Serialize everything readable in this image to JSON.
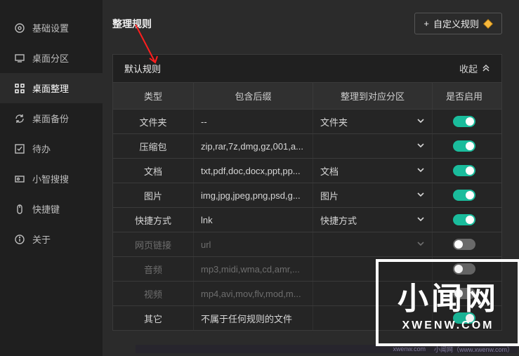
{
  "sidebar": {
    "items": [
      {
        "label": "基础设置",
        "icon": "gear-outline-icon",
        "active": false
      },
      {
        "label": "桌面分区",
        "icon": "monitor-icon",
        "active": false
      },
      {
        "label": "桌面整理",
        "icon": "grid-icon",
        "active": true
      },
      {
        "label": "桌面备份",
        "icon": "refresh-icon",
        "active": false
      },
      {
        "label": "待办",
        "icon": "checkbox-icon",
        "active": false
      },
      {
        "label": "小智搜搜",
        "icon": "search-box-icon",
        "active": false
      },
      {
        "label": "快捷键",
        "icon": "mouse-icon",
        "active": false
      },
      {
        "label": "关于",
        "icon": "info-icon",
        "active": false
      }
    ]
  },
  "section_title": "整理规则",
  "custom_rule_button": {
    "plus": "+",
    "label": "自定义规则"
  },
  "panel": {
    "title": "默认规则",
    "collapse_label": "收起"
  },
  "columns": {
    "type": "类型",
    "suffix": "包含后缀",
    "target": "整理到对应分区",
    "enabled": "是否启用"
  },
  "rows": [
    {
      "type": "文件夹",
      "suffix": "--",
      "target": "文件夹",
      "has_target": true,
      "enabled": true,
      "disabled": false
    },
    {
      "type": "压缩包",
      "suffix": "zip,rar,7z,dmg,gz,001,a...",
      "target": "",
      "has_target": true,
      "enabled": true,
      "disabled": false
    },
    {
      "type": "文档",
      "suffix": "txt,pdf,doc,docx,ppt,pp...",
      "target": "文档",
      "has_target": true,
      "enabled": true,
      "disabled": false
    },
    {
      "type": "图片",
      "suffix": "img,jpg,jpeg,png,psd,g...",
      "target": "图片",
      "has_target": true,
      "enabled": true,
      "disabled": false
    },
    {
      "type": "快捷方式",
      "suffix": "lnk",
      "target": "快捷方式",
      "has_target": true,
      "enabled": true,
      "disabled": false
    },
    {
      "type": "网页链接",
      "suffix": "url",
      "target": "",
      "has_target": true,
      "enabled": false,
      "disabled": true
    },
    {
      "type": "音频",
      "suffix": "mp3,midi,wma,cd,amr,...",
      "target": "",
      "has_target": false,
      "enabled": false,
      "disabled": true
    },
    {
      "type": "视频",
      "suffix": "mp4,avi,mov,flv,mod,m...",
      "target": "",
      "has_target": false,
      "enabled": false,
      "disabled": true
    },
    {
      "type": "其它",
      "suffix": "不属于任何规则的文件",
      "target": "",
      "has_target": false,
      "enabled": true,
      "disabled": false
    }
  ],
  "watermark": {
    "big": "小闻网",
    "sub": "XWENW.COM",
    "bar_left": "xwenw.com",
    "bar_right": "小闻网（www.xwenw.com）"
  }
}
